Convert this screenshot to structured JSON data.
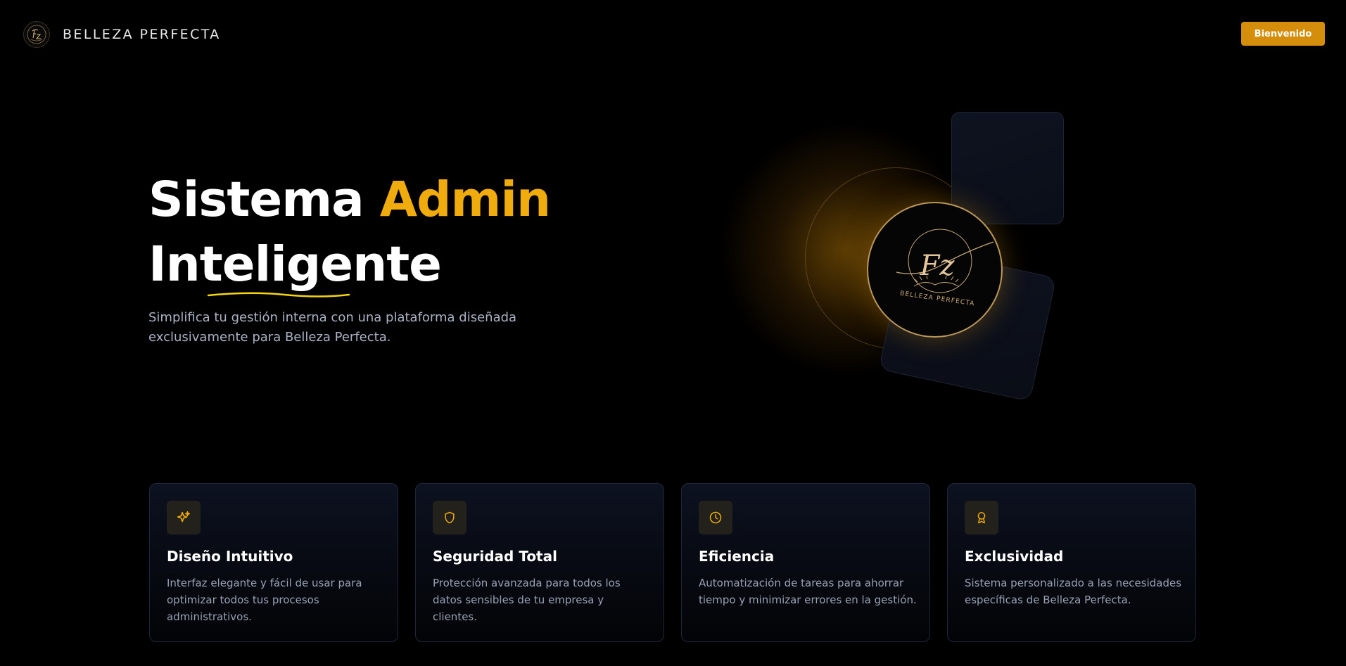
{
  "header": {
    "brand_name": "BELLEZA PERFECTA",
    "cta_label": "Bienvenido"
  },
  "hero": {
    "title_part1": "Sistema ",
    "title_accent": "Admin",
    "title_line2": "Inteligente",
    "subtitle": "Simplifica tu gestión interna con una plataforma diseñada exclusivamente para Belleza Perfecta.",
    "logo_monogram": "Fz",
    "logo_caption": "BELLEZA PERFECTA"
  },
  "features": [
    {
      "icon": "sparkles-icon",
      "title": "Diseño Intuitivo",
      "description": "Interfaz elegante y fácil de usar para optimizar todos tus procesos administrativos."
    },
    {
      "icon": "shield-icon",
      "title": "Seguridad Total",
      "description": "Protección avanzada para todos los datos sensibles de tu empresa y clientes."
    },
    {
      "icon": "clock-icon",
      "title": "Eficiencia",
      "description": "Automatización de tareas para ahorrar tiempo y minimizar errores en la gestión."
    },
    {
      "icon": "award-icon",
      "title": "Exclusividad",
      "description": "Sistema personalizado a las necesidades específicas de Belleza Perfecta."
    }
  ],
  "colors": {
    "accent": "#f0ab0c",
    "button": "#d48e0b",
    "background": "#000000",
    "card": "#0d1220",
    "text_muted": "#aab2c4"
  }
}
